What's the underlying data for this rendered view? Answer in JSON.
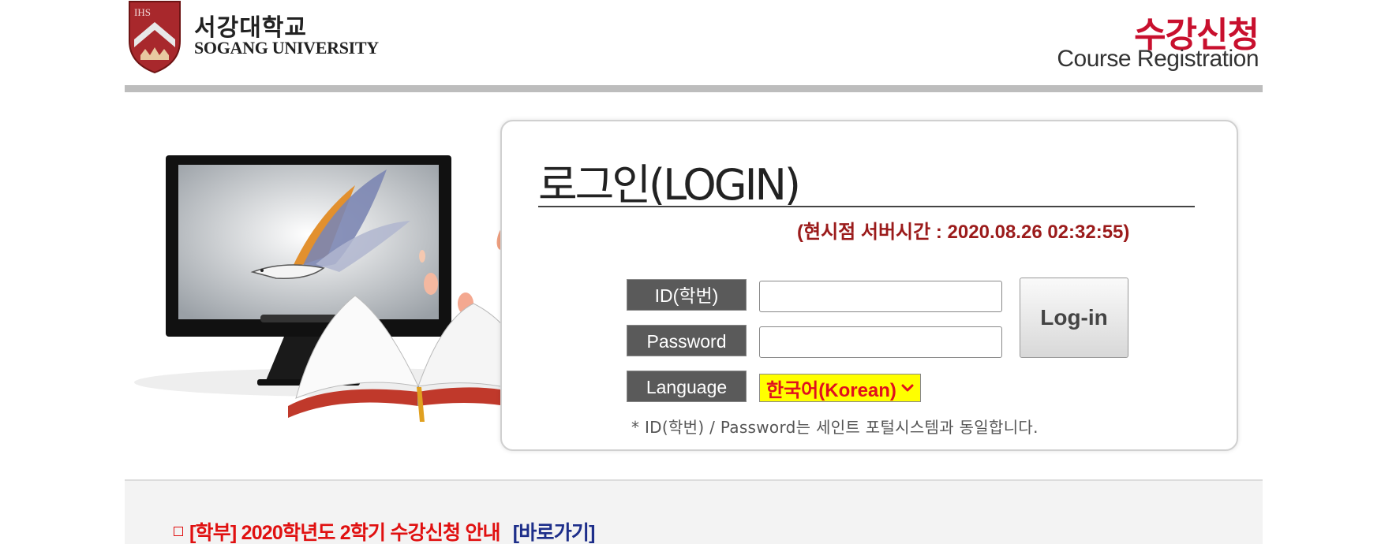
{
  "header": {
    "school_name_kr": "서강대학교",
    "school_name_en": "SOGANG UNIVERSITY",
    "crest_text": "IHS",
    "title_kr": "수강신청",
    "title_en": "Course Registration"
  },
  "login": {
    "title": "로그인(LOGIN)",
    "server_time": "(현시점 서버시간 : 2020.08.26 02:32:55)",
    "id_label": "ID(학번)",
    "password_label": "Password",
    "language_label": "Language",
    "id_value": "",
    "password_value": "",
    "button_label": "Log-in",
    "language_selected": "한국어(Korean)",
    "note": "* ID(학번) / Password는 세인트 포털시스템과 동일합니다."
  },
  "notice": {
    "text": "[학부] 2020학년도 2학기 수강신청 안내",
    "link_label": "[바로가기]"
  },
  "colors": {
    "brand_red": "#c8102e",
    "server_time": "#9b1b1b",
    "select_bg": "#ffff00",
    "notice_red": "#e01010",
    "notice_link": "#1d2e8a"
  }
}
